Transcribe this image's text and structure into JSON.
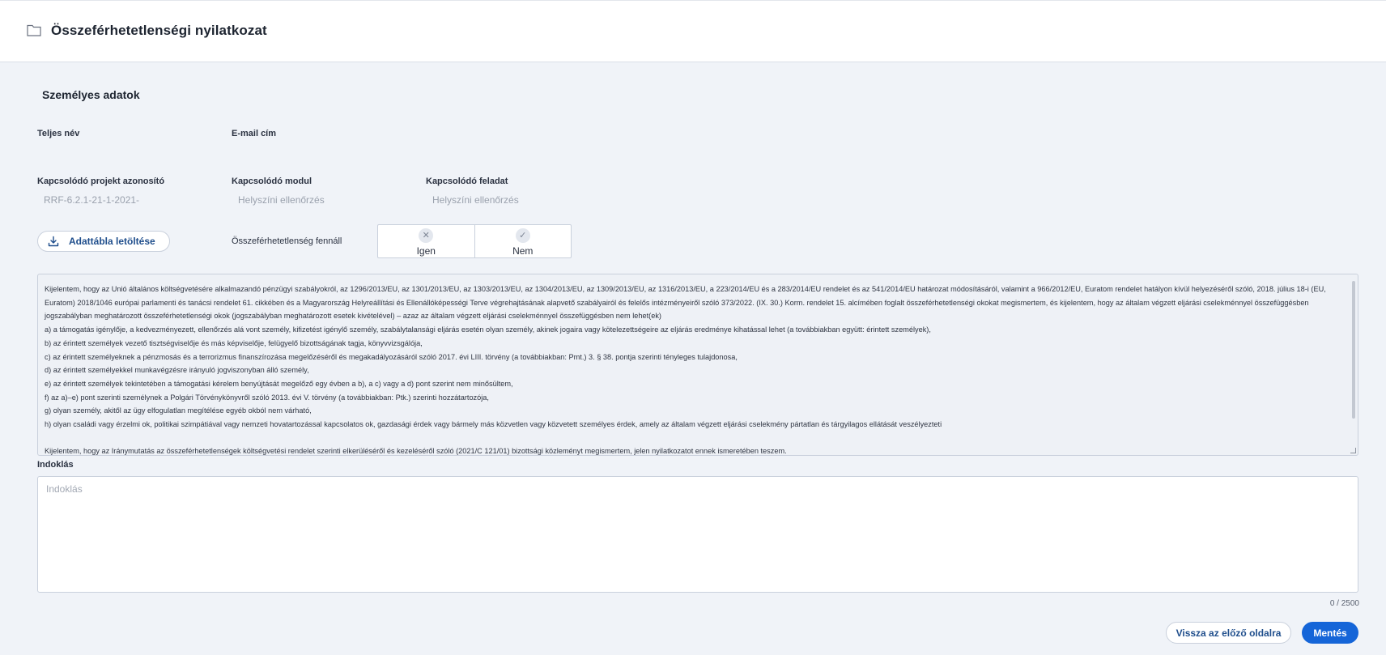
{
  "header": {
    "title": "Összeférhetetlenségi nyilatkozat",
    "icon": "folder-icon"
  },
  "personal": {
    "section_title": "Személyes adatok",
    "full_name_label": "Teljes név",
    "email_label": "E-mail cím",
    "project_id_label": "Kapcsolódó projekt azonosító",
    "project_id_value": "RRF-6.2.1-21-1-2021-",
    "module_label": "Kapcsolódó modul",
    "module_value": "Helyszíni ellenőrzés",
    "task_label": "Kapcsolódó feladat",
    "task_value": "Helyszíni ellenőrzés"
  },
  "download": {
    "label": "Adattábla letöltése",
    "icon": "download-icon"
  },
  "conflict": {
    "label": "Összeférhetetlenség fennáll",
    "options": [
      {
        "label": "Igen",
        "icon": "close-icon",
        "glyph": "✕"
      },
      {
        "label": "Nem",
        "icon": "check-icon",
        "glyph": "✓"
      }
    ]
  },
  "declaration": {
    "lines": [
      "Kijelentem, hogy az Unió általános költségvetésére alkalmazandó pénzügyi szabályokról, az 1296/2013/EU, az 1301/2013/EU, az 1303/2013/EU, az 1304/2013/EU, az 1309/2013/EU, az 1316/2013/EU, a 223/2014/EU és a 283/2014/EU rendelet és az 541/2014/EU határozat módosításáról, valamint a 966/2012/EU, Euratom rendelet hatályon kívül helyezéséről szóló, 2018. július 18-i (EU, Euratom) 2018/1046 európai parlamenti és tanácsi rendelet 61. cikkében és a Magyarország Helyreállítási és Ellenállóképességi Terve végrehajtásának alapvető szabályairól és felelős intézményeiről szóló 373/2022. (IX. 30.) Korm. rendelet 15. alcímében foglalt összeférhetetlenségi okokat megismertem, és kijelentem, hogy az általam végzett eljárási cselekménnyel összefüggésben jogszabályban meghatározott összeférhetetlenségi okok (jogszabályban meghatározott esetek kivételével) – azaz az általam végzett eljárási cselekménnyel összefüggésben nem lehet(ek)",
      "a) a támogatás igénylője, a kedvezményezett, ellenőrzés alá vont személy, kifizetést igénylő személy, szabálytalansági eljárás esetén olyan személy, akinek jogaira vagy kötelezettségeire az eljárás eredménye kihatással lehet (a továbbiakban együtt: érintett személyek),",
      "b) az érintett személyek vezető tisztségviselője és más képviselője, felügyelő bizottságának tagja, könyvvizsgálója,",
      "c) az érintett személyeknek a pénzmosás és a terrorizmus finanszírozása megelőzéséről és megakadályozásáról szóló 2017. évi LIII. törvény (a továbbiakban: Pmt.) 3. § 38. pontja szerinti tényleges tulajdonosa,",
      "d) az érintett személyekkel munkavégzésre irányuló jogviszonyban álló személy,",
      "e) az érintett személyek tekintetében a támogatási kérelem benyújtását megelőző egy évben a b), a c) vagy a d) pont szerint nem minősültem,",
      "f) az a)–e) pont szerinti személynek a Polgári Törvénykönyvről szóló 2013. évi V. törvény (a továbbiakban: Ptk.) szerinti hozzátartozója,",
      "g) olyan személy, akitől az ügy elfogulatlan megítélése egyéb okból nem várható,",
      "h) olyan családi vagy érzelmi ok, politikai szimpátiával vagy nemzeti hovatartozással kapcsolatos ok, gazdasági érdek vagy bármely más közvetlen vagy közvetett személyes érdek, amely az általam végzett eljárási cselekmény pártatlan és tárgyilagos ellátását veszélyezteti",
      "",
      "Kijelentem, hogy az Iránymutatás az összeférhetetlenségek költségvetési rendelet szerinti elkerüléséről és kezeléséről szóló (2021/C 121/01) bizottsági közleményt megismertem, jelen nyilatkozatot ennek ismeretében teszem."
    ]
  },
  "reason": {
    "label": "Indoklás",
    "placeholder": "Indoklás",
    "value": "",
    "counter": "0 / 2500"
  },
  "actions": {
    "back_label": "Vissza az előző oldalra",
    "save_label": "Mentés"
  }
}
